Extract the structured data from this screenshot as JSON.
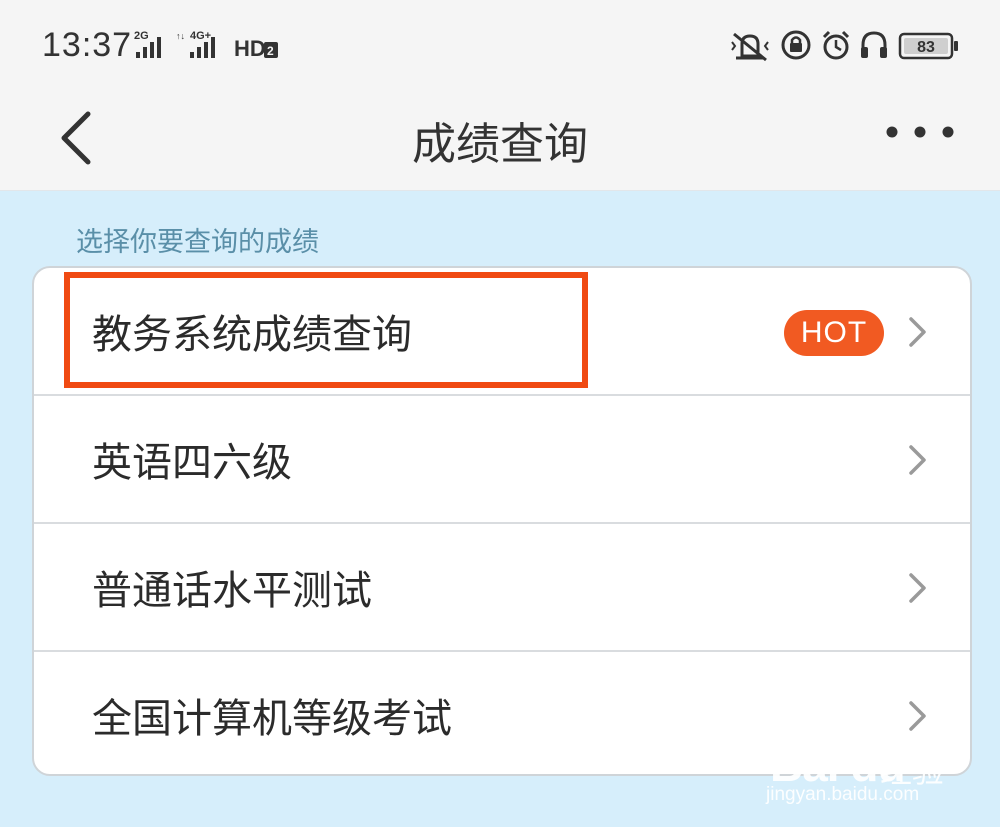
{
  "status_bar": {
    "time": "13:37",
    "network_1": "2G",
    "network_2": "4G+",
    "hd_label": "HD",
    "hd_sub": "2",
    "battery": "83",
    "icons": [
      "signal-2g-icon",
      "signal-4g-icon",
      "volte-hd-icon",
      "vibrate-icon",
      "rotation-lock-icon",
      "alarm-icon",
      "headset-icon",
      "battery-icon"
    ]
  },
  "nav": {
    "title": "成绩查询",
    "back_icon": "chevron-left-icon",
    "more_icon": "more-icon"
  },
  "section_label": "选择你要查询的成绩",
  "items": [
    {
      "label": "教务系统成绩查询",
      "badge": "HOT",
      "highlighted": true
    },
    {
      "label": "英语四六级"
    },
    {
      "label": "普通话水平测试"
    },
    {
      "label": "全国计算机等级考试"
    }
  ],
  "colors": {
    "page_bg": "#d6eefb",
    "badge": "#f15a22",
    "highlight_border": "#f04a12",
    "section_label": "#5a8fa8"
  },
  "watermark": {
    "logo": "Bai du",
    "cn": "经验",
    "url": "jingyan.baidu.com"
  }
}
